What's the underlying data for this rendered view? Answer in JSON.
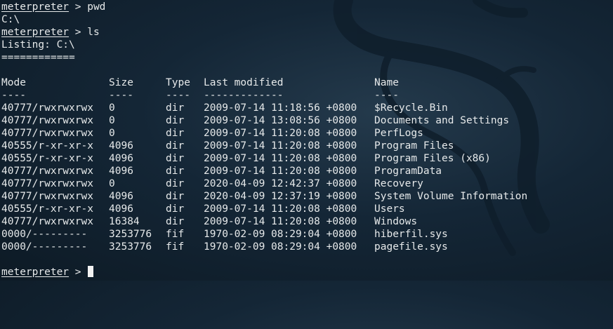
{
  "prompt": "meterpreter",
  "commands": {
    "pwd": " > pwd",
    "pwd_output": "C:\\",
    "ls": " > ls",
    "listing": "Listing: C:\\",
    "underline": "============",
    "prompt_suffix": " > "
  },
  "table": {
    "headers": [
      "Mode",
      "Size",
      "Type",
      "Last modified",
      "Name"
    ],
    "separators": [
      "----",
      "----",
      "----",
      "-------------",
      "----"
    ],
    "rows": [
      [
        "40777/rwxrwxrwx",
        "0",
        "dir",
        "2009-07-14 11:18:56 +0800",
        "$Recycle.Bin"
      ],
      [
        "40777/rwxrwxrwx",
        "0",
        "dir",
        "2009-07-14 13:08:56 +0800",
        "Documents and Settings"
      ],
      [
        "40777/rwxrwxrwx",
        "0",
        "dir",
        "2009-07-14 11:20:08 +0800",
        "PerfLogs"
      ],
      [
        "40555/r-xr-xr-x",
        "4096",
        "dir",
        "2009-07-14 11:20:08 +0800",
        "Program Files"
      ],
      [
        "40555/r-xr-xr-x",
        "4096",
        "dir",
        "2009-07-14 11:20:08 +0800",
        "Program Files (x86)"
      ],
      [
        "40777/rwxrwxrwx",
        "4096",
        "dir",
        "2009-07-14 11:20:08 +0800",
        "ProgramData"
      ],
      [
        "40777/rwxrwxrwx",
        "0",
        "dir",
        "2020-04-09 12:42:37 +0800",
        "Recovery"
      ],
      [
        "40777/rwxrwxrwx",
        "4096",
        "dir",
        "2020-04-09 12:37:19 +0800",
        "System Volume Information"
      ],
      [
        "40555/r-xr-xr-x",
        "4096",
        "dir",
        "2009-07-14 11:20:08 +0800",
        "Users"
      ],
      [
        "40777/rwxrwxrwx",
        "16384",
        "dir",
        "2009-07-14 11:20:08 +0800",
        "Windows"
      ],
      [
        "0000/---------",
        "3253776",
        "fif",
        "1970-02-09 08:29:04 +0800",
        "hiberfil.sys"
      ],
      [
        "0000/---------",
        "3253776",
        "fif",
        "1970-02-09 08:29:04 +0800",
        "pagefile.sys"
      ]
    ]
  },
  "colors": {
    "background": "#142636",
    "text": "#e6e9ea",
    "cursor": "#f2f2f2",
    "watermark": "#1e3344"
  },
  "watermark_icon": "kali-dragon-icon"
}
